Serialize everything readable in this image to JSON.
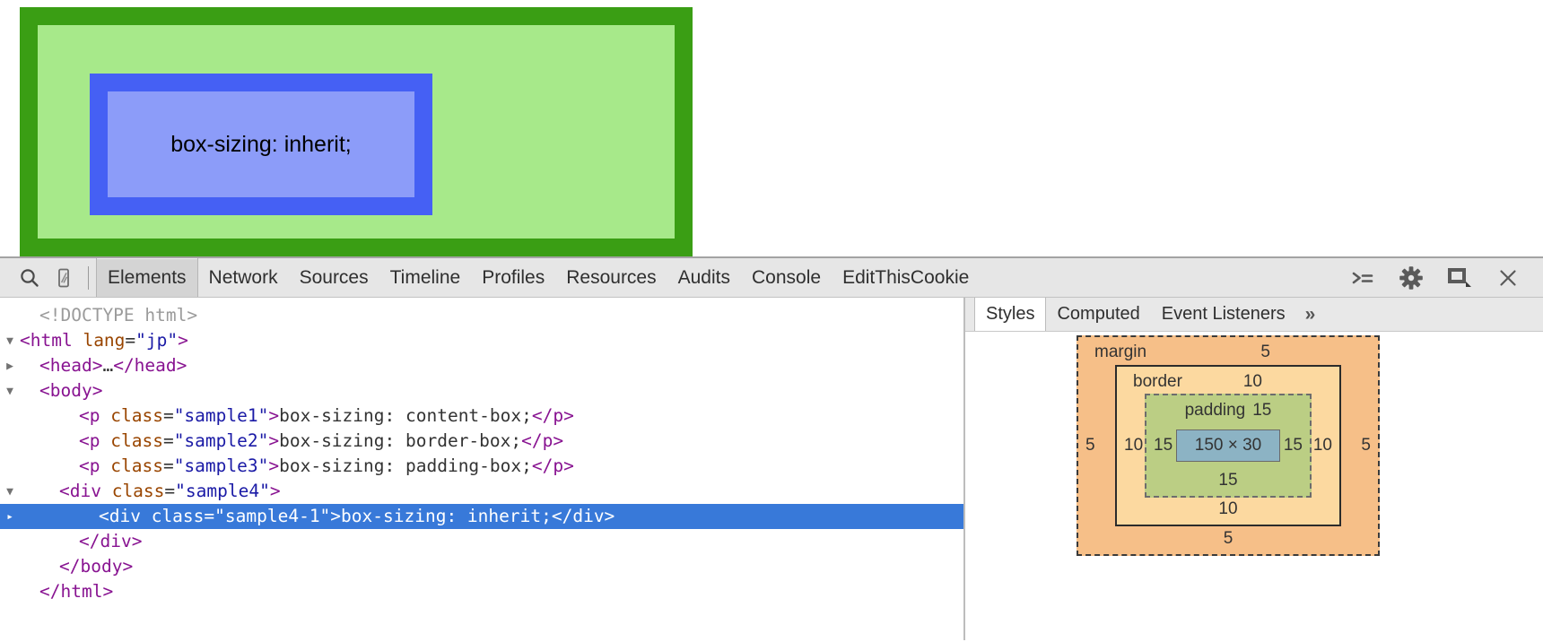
{
  "demo": {
    "inner_text": "box-sizing: inherit;",
    "outer_border_color": "#3a9e14",
    "outer_bg_color": "#a7e98a",
    "inner_border_color": "#4560f4",
    "inner_bg_color": "#8c9cf9"
  },
  "toolbar": {
    "icons": {
      "search": "search-icon",
      "inspect": "inspect-element-icon",
      "drawer": "console-drawer-icon",
      "settings": "gear-icon",
      "dock": "dock-panel-icon",
      "close": "close-icon"
    },
    "tabs": [
      {
        "label": "Elements",
        "active": true
      },
      {
        "label": "Network",
        "active": false
      },
      {
        "label": "Sources",
        "active": false
      },
      {
        "label": "Timeline",
        "active": false
      },
      {
        "label": "Profiles",
        "active": false
      },
      {
        "label": "Resources",
        "active": false
      },
      {
        "label": "Audits",
        "active": false
      },
      {
        "label": "Console",
        "active": false
      },
      {
        "label": "EditThisCookie",
        "active": false
      }
    ]
  },
  "dom_tree": {
    "lines": [
      {
        "arrow": "",
        "indent": 22,
        "segments": [
          {
            "cls": "doctype",
            "text": "<!DOCTYPE html>"
          }
        ]
      },
      {
        "arrow": "▼",
        "indent": 0,
        "segments": [
          {
            "cls": "tag",
            "text": "<html "
          },
          {
            "cls": "attr",
            "text": "lang"
          },
          {
            "cls": "txt",
            "text": "="
          },
          {
            "cls": "val",
            "text": "\"jp\""
          },
          {
            "cls": "tag",
            "text": ">"
          }
        ]
      },
      {
        "arrow": "▶",
        "indent": 22,
        "segments": [
          {
            "cls": "tag",
            "text": "<head>"
          },
          {
            "cls": "txt",
            "text": "…"
          },
          {
            "cls": "tag",
            "text": "</head>"
          }
        ]
      },
      {
        "arrow": "▼",
        "indent": 22,
        "segments": [
          {
            "cls": "tag",
            "text": "<body>"
          }
        ]
      },
      {
        "arrow": "",
        "indent": 66,
        "segments": [
          {
            "cls": "tag",
            "text": "<p "
          },
          {
            "cls": "attr",
            "text": "class"
          },
          {
            "cls": "txt",
            "text": "="
          },
          {
            "cls": "val",
            "text": "\"sample1\""
          },
          {
            "cls": "tag",
            "text": ">"
          },
          {
            "cls": "txt",
            "text": "box-sizing: content-box;"
          },
          {
            "cls": "tag",
            "text": "</p>"
          }
        ]
      },
      {
        "arrow": "",
        "indent": 66,
        "segments": [
          {
            "cls": "tag",
            "text": "<p "
          },
          {
            "cls": "attr",
            "text": "class"
          },
          {
            "cls": "txt",
            "text": "="
          },
          {
            "cls": "val",
            "text": "\"sample2\""
          },
          {
            "cls": "tag",
            "text": ">"
          },
          {
            "cls": "txt",
            "text": "box-sizing: border-box;"
          },
          {
            "cls": "tag",
            "text": "</p>"
          }
        ]
      },
      {
        "arrow": "",
        "indent": 66,
        "segments": [
          {
            "cls": "tag",
            "text": "<p "
          },
          {
            "cls": "attr",
            "text": "class"
          },
          {
            "cls": "txt",
            "text": "="
          },
          {
            "cls": "val",
            "text": "\"sample3\""
          },
          {
            "cls": "tag",
            "text": ">"
          },
          {
            "cls": "txt",
            "text": "box-sizing: padding-box;"
          },
          {
            "cls": "tag",
            "text": "</p>"
          }
        ]
      },
      {
        "arrow": "▼",
        "indent": 44,
        "segments": [
          {
            "cls": "tag",
            "text": "<div "
          },
          {
            "cls": "attr",
            "text": "class"
          },
          {
            "cls": "txt",
            "text": "="
          },
          {
            "cls": "val",
            "text": "\"sample4\""
          },
          {
            "cls": "tag",
            "text": ">"
          }
        ]
      },
      {
        "arrow": "",
        "indent": 88,
        "selected": true,
        "segments": [
          {
            "cls": "tag",
            "text": "<div "
          },
          {
            "cls": "attr",
            "text": "class"
          },
          {
            "cls": "txt",
            "text": "="
          },
          {
            "cls": "val",
            "text": "\"sample4-1\""
          },
          {
            "cls": "tag",
            "text": ">"
          },
          {
            "cls": "txt",
            "text": "box-sizing: inherit;"
          },
          {
            "cls": "tag",
            "text": "</div>"
          }
        ]
      },
      {
        "arrow": "",
        "indent": 66,
        "segments": [
          {
            "cls": "tag",
            "text": "</div>"
          }
        ]
      },
      {
        "arrow": "",
        "indent": 44,
        "segments": [
          {
            "cls": "tag",
            "text": "</body>"
          }
        ]
      },
      {
        "arrow": "",
        "indent": 22,
        "segments": [
          {
            "cls": "tag",
            "text": "</html>"
          }
        ]
      }
    ],
    "selected_highlight_color": "#3879d9"
  },
  "style_pane": {
    "tabs": [
      {
        "label": "Styles",
        "active": true
      },
      {
        "label": "Computed",
        "active": false
      },
      {
        "label": "Event Listeners",
        "active": false
      }
    ],
    "more_glyph": "»",
    "box_model": {
      "margin": {
        "label": "margin",
        "top": "5",
        "right": "5",
        "bottom": "5",
        "left": "5",
        "color": "#f6bf88"
      },
      "border": {
        "label": "border",
        "top": "10",
        "right": "10",
        "bottom": "10",
        "left": "10",
        "color": "#fcd9a0"
      },
      "padding": {
        "label": "padding",
        "top": "15",
        "right": "15",
        "bottom": "15",
        "left": "15",
        "color": "#bbce84"
      },
      "content": {
        "size": "150 × 30",
        "color": "#8cb3c4"
      }
    }
  }
}
